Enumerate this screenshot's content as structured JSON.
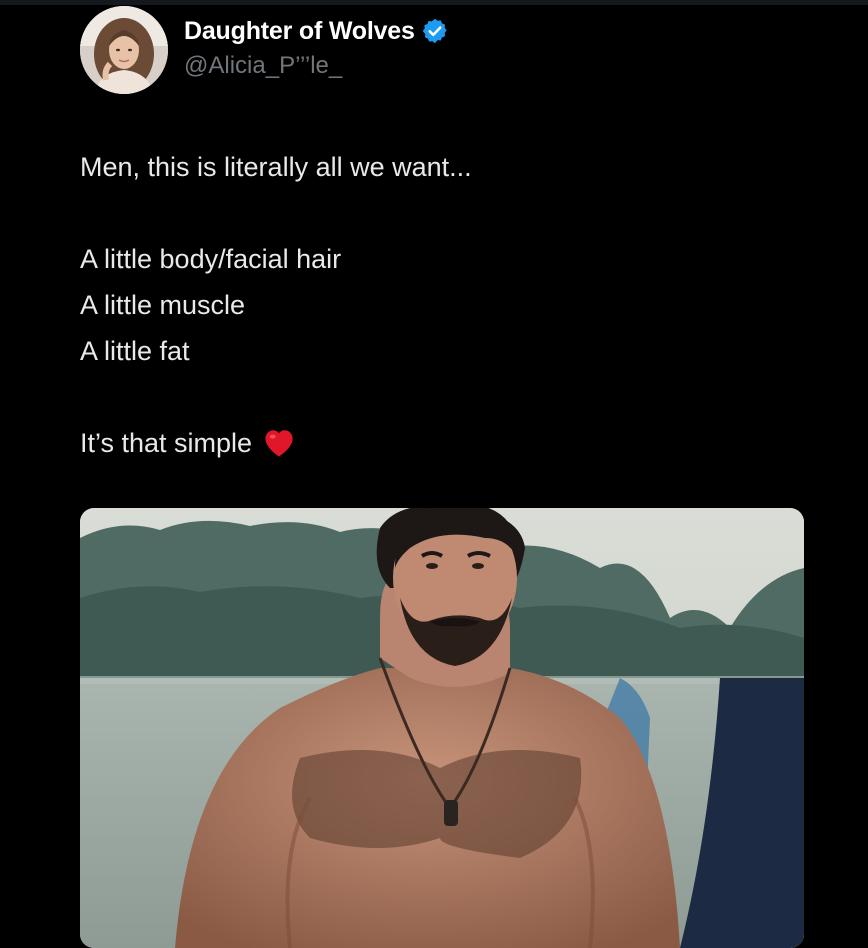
{
  "tweet": {
    "author": {
      "display_name": "Daughter of Wolves",
      "handle": "@Alicia_P’’’le_",
      "verified": true,
      "verified_icon": "verified-badge-icon",
      "avatar_icon": "profile-photo"
    },
    "text": {
      "line1": "Men, this is literally all we want...",
      "line2": "A little body/facial hair",
      "line3": "A little muscle",
      "line4": "A little fat",
      "line5": "It’s that simple"
    },
    "emoji": "red-heart-icon",
    "media": {
      "type": "photo",
      "icon": "photo-shirtless-bearded-man"
    }
  },
  "colors": {
    "background": "#000000",
    "text": "#e7e9ea",
    "secondary_text": "#71767b",
    "verified_blue": "#1d9bf0",
    "heart_red": "#e0162b"
  }
}
